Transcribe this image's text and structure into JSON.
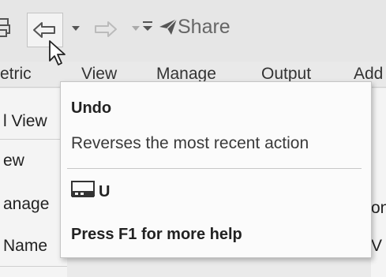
{
  "qat": {
    "share_label": "Share",
    "save_icon": "printer-icon",
    "undo_icon": "undo-arrow-icon",
    "redo_icon": "redo-arrow-icon",
    "customize_icon": "customize-qat-icon",
    "share_icon": "paper-plane-icon"
  },
  "ribbon": {
    "tabs": [
      "etric",
      "View",
      "Manage",
      "Output",
      "Add"
    ]
  },
  "left_list": {
    "rows": [
      "l View",
      "ew",
      "anage",
      "Name"
    ]
  },
  "right_grid": {
    "rows": [
      "on",
      "V"
    ]
  },
  "tooltip": {
    "title": "Undo",
    "description": "Reverses the most recent action",
    "shortcut_key": "U",
    "keyboard_icon": "keyboard-icon",
    "help": "Press F1 for more help"
  },
  "colors": {
    "background": "#eaeaea",
    "tooltip_bg": "#fbfbfb",
    "accent_border": "#c3c3c3"
  }
}
